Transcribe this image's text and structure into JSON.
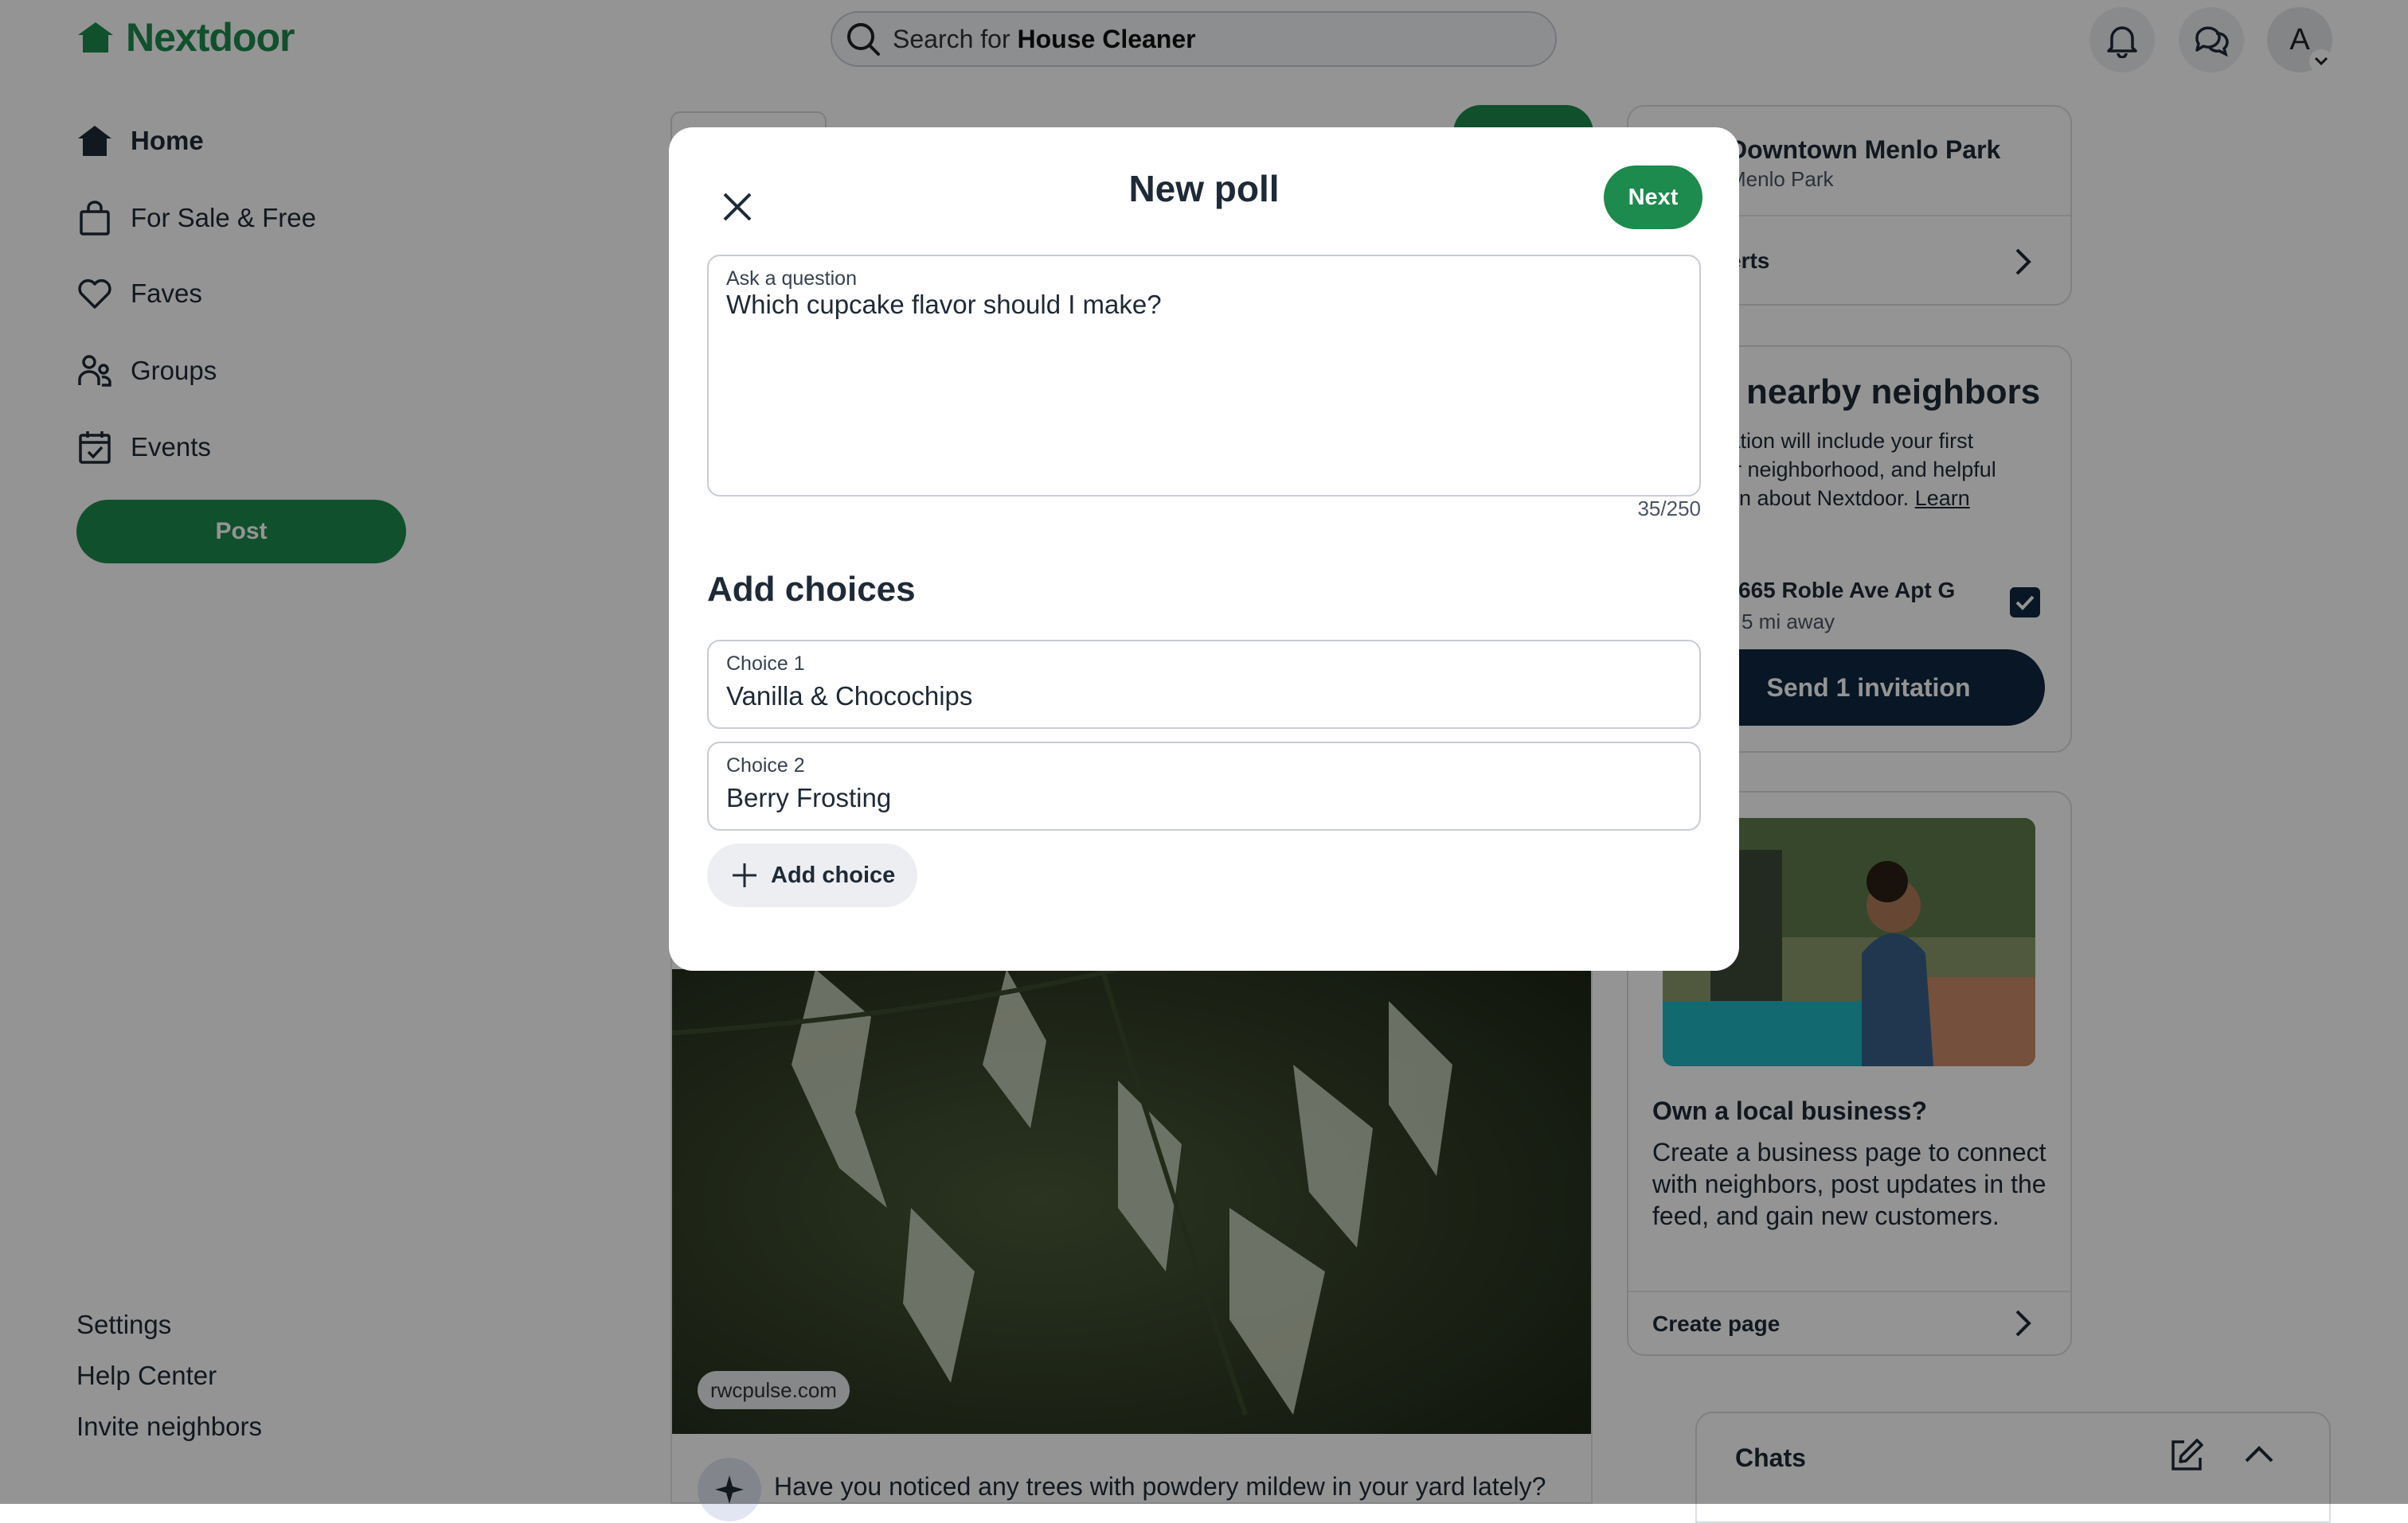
{
  "app": {
    "name": "Nextdoor",
    "brand_color": "#1d8a4e",
    "dark_navy": "#0f2640"
  },
  "header": {
    "search_prefix": "Search for",
    "search_term": "House Cleaner",
    "avatar_initial": "A",
    "icons": [
      "bell-icon",
      "chat-bubbles-icon",
      "chevron-down-icon"
    ]
  },
  "sidebar": {
    "items": [
      {
        "label": "Home",
        "icon": "home-icon",
        "active": true
      },
      {
        "label": "For Sale & Free",
        "icon": "shopping-bag-icon",
        "active": false
      },
      {
        "label": "Faves",
        "icon": "heart-icon",
        "active": false
      },
      {
        "label": "Groups",
        "icon": "groups-icon",
        "active": false
      },
      {
        "label": "Events",
        "icon": "calendar-icon",
        "active": false
      }
    ],
    "post_label": "Post",
    "footer_links": [
      "Settings",
      "Help Center",
      "Invite neighbors"
    ]
  },
  "feed": {
    "source": "rwcpulse.com",
    "question": "Have you noticed any trees with powdery mildew in your yard lately?"
  },
  "right_rail": {
    "neighborhood": {
      "title": "Downtown Menlo Park",
      "subtitle": "Menlo Park",
      "alerts_label": "erts"
    },
    "invite": {
      "title": "nearby neighbors",
      "body_line1": "tation will include your first",
      "body_line2": "ur neighborhood, and helpful",
      "body_line3": "ion about Nextdoor.",
      "learn": "Learn",
      "address": "665 Roble Ave Apt G",
      "distance": "5 mi away",
      "checked": true,
      "send_label": "Send 1 invitation"
    },
    "business": {
      "title": "Own a local business?",
      "body": "Create a business page to connect with neighbors, post updates in the feed, and gain new customers.",
      "cta": "Create page"
    },
    "chats": {
      "title": "Chats"
    }
  },
  "modal": {
    "title": "New poll",
    "next_label": "Next",
    "question": {
      "label": "Ask a question",
      "value": "Which cupcake flavor should I make?",
      "counter": "35/250"
    },
    "choices_title": "Add choices",
    "choices": [
      {
        "label": "Choice 1",
        "value": "Vanilla & Chocochips"
      },
      {
        "label": "Choice 2",
        "value": "Berry Frosting"
      }
    ],
    "add_choice_label": "Add choice"
  }
}
